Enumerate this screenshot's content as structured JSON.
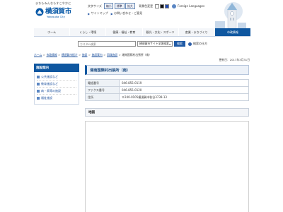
{
  "header": {
    "logo_tagline": "まちもみんなもすこやかに",
    "logo_name": "横須賀市",
    "logo_sub": "Yokosuka City",
    "text_size_label": "文字サイズ",
    "text_size_buttons": [
      "縮小",
      "標準",
      "拡大"
    ],
    "bg_color_label": "背景色変更",
    "bg_colors": [
      "白",
      "黒",
      "青"
    ],
    "foreign_languages": "Foreign Languages",
    "sitemap": "サイトマップ",
    "contact": "お問い合わせ・ご意見"
  },
  "nav": {
    "items": [
      "ホーム",
      "くらし・環境",
      "健康・福祉・教育",
      "観光・文化・スポーツ",
      "産業・まちづくり",
      "市政情報"
    ],
    "active_index": 5
  },
  "search": {
    "placeholder": "カスタム検索",
    "scope": "横須賀市サイト全体検索",
    "button": "検索",
    "howto": "検索の仕方"
  },
  "breadcrumb": [
    "ホーム",
    "市政情報",
    "横須賀市紹介",
    "施設",
    "施設案内",
    "同政施設",
    "湘南国際村出張所（南）"
  ],
  "updated": "更新日：2017年3月31日",
  "sidebar": {
    "title": "施設案内",
    "items": [
      "公共施設など",
      "教育施設など",
      "病・県等の施設",
      "福祉施設"
    ]
  },
  "main": {
    "title": "湘南国際村出張所（南）",
    "info_rows": [
      {
        "label": "電話番号",
        "value": "046-855-0119"
      },
      {
        "label": "ファクス番号",
        "value": "046-855-0120"
      },
      {
        "label": "住所",
        "value": "〒240-0105横須賀市秋谷3739-13"
      }
    ],
    "map_heading": "地図"
  },
  "colors": {
    "brand": "#0f57a0",
    "link": "#1b4f9c"
  }
}
